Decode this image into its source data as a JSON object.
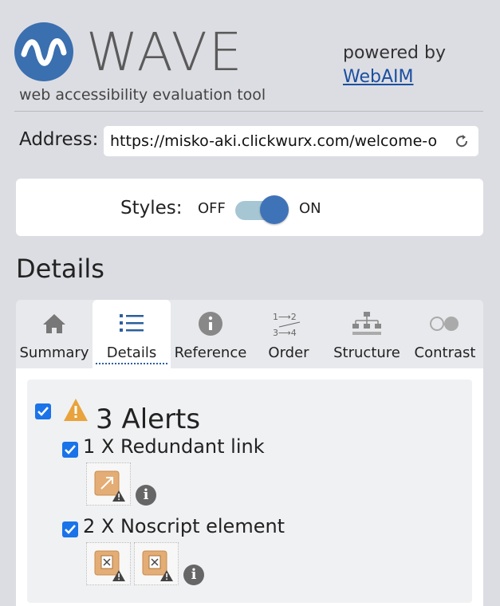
{
  "header": {
    "logo_text": "WAVE",
    "tagline": "web accessibility evaluation tool",
    "powered_by": "powered by",
    "webaim_link": "WebAIM"
  },
  "address": {
    "label": "Address:",
    "value": "https://misko-aki.clickwurx.com/welcome-o"
  },
  "styles": {
    "label": "Styles:",
    "off": "OFF",
    "on": "ON",
    "state": "on"
  },
  "details_heading": "Details",
  "tabs": [
    {
      "label": "Summary",
      "icon": "home-icon"
    },
    {
      "label": "Details",
      "icon": "list-icon",
      "active": true
    },
    {
      "label": "Reference",
      "icon": "info-icon"
    },
    {
      "label": "Order",
      "icon": "order-icon"
    },
    {
      "label": "Structure",
      "icon": "structure-icon"
    },
    {
      "label": "Contrast",
      "icon": "contrast-icon"
    }
  ],
  "alerts": {
    "title": "3 Alerts",
    "items": [
      {
        "label": "1 X Redundant link",
        "icon_count": 1
      },
      {
        "label": "2 X Noscript element",
        "icon_count": 2
      }
    ]
  },
  "colors": {
    "accent": "#3a6fb0",
    "checkbox": "#1a73e8",
    "alert": "#e8a33d",
    "background": "#dcdde2"
  }
}
